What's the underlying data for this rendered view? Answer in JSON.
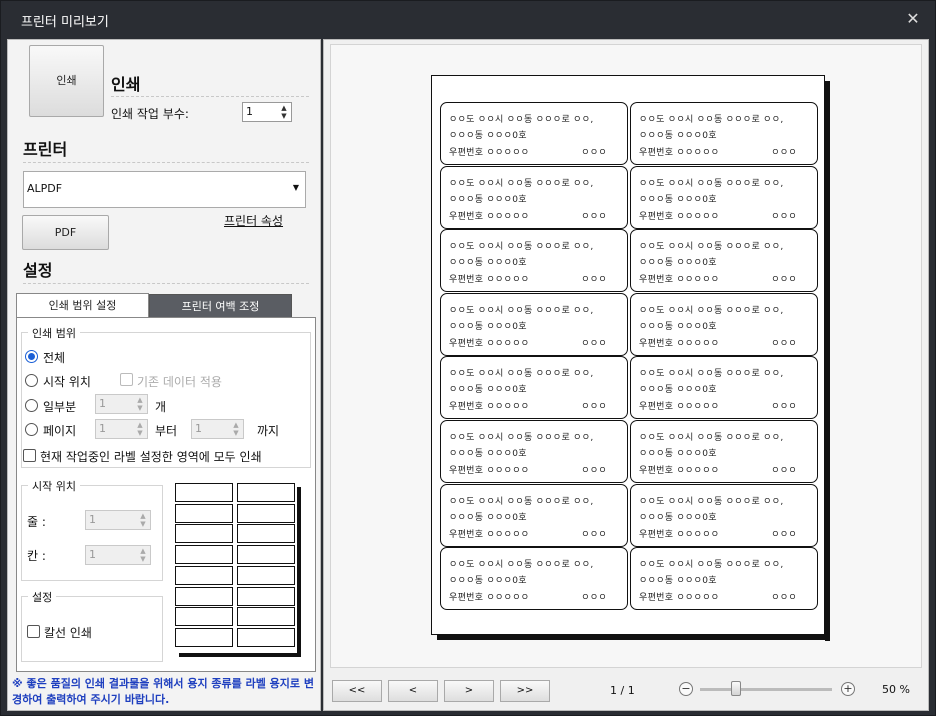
{
  "window": {
    "title": "프린터 미리보기",
    "close_glyph": "✕"
  },
  "print": {
    "button_label": "인쇄",
    "heading": "인쇄",
    "copies_label": "인쇄 작업 부수:",
    "copies_value": "1"
  },
  "printer": {
    "heading": "프린터",
    "selected": "ALPDF",
    "properties_link": "프린터 속성",
    "pdf_button": "PDF"
  },
  "settings": {
    "heading": "설정",
    "tabs": [
      {
        "label": "인쇄 범위 설정",
        "active": true
      },
      {
        "label": "프린터 여백 조정",
        "active": false
      }
    ],
    "range": {
      "legend": "인쇄 범위",
      "all": "전체",
      "start_pos": "시작 위치",
      "keep_data": "기존 데이터 적용",
      "partial": "일부분",
      "partial_value": "1",
      "partial_unit": "개",
      "page": "페이지",
      "page_from": "1",
      "from_label": "부터",
      "page_to": "1",
      "to_label": "까지",
      "current_area": "현재 작업중인 라벨 설정한 영역에 모두 인쇄"
    },
    "start": {
      "legend": "시작 위치",
      "row_label": "줄 :",
      "row_value": "1",
      "col_label": "칸 :",
      "col_value": "1"
    },
    "options": {
      "legend": "설정",
      "color_line": "칼선 인쇄"
    }
  },
  "notice": "※ 좋은 품질의 인쇄 결과물을 위해서 용지 종류를 라벨 용지로 변경하여 출력하여 주시기 바랍니다.",
  "label_text": {
    "line1": "ㅇㅇ도 ㅇㅇ시 ㅇㅇ동 ㅇㅇㅇ로 ㅇㅇ,",
    "line2": "ㅇㅇㅇ동 ㅇㅇㅇ0호",
    "line3": "우편번호 ㅇㅇㅇㅇㅇ",
    "line4": "ㅇㅇㅇ"
  },
  "nav": {
    "first": "<<",
    "prev": "<",
    "next": ">",
    "last": ">>",
    "page": "1 / 1",
    "zoom_minus": "−",
    "zoom_plus": "+",
    "zoom": "50 %",
    "zoom_level": 0.25
  }
}
